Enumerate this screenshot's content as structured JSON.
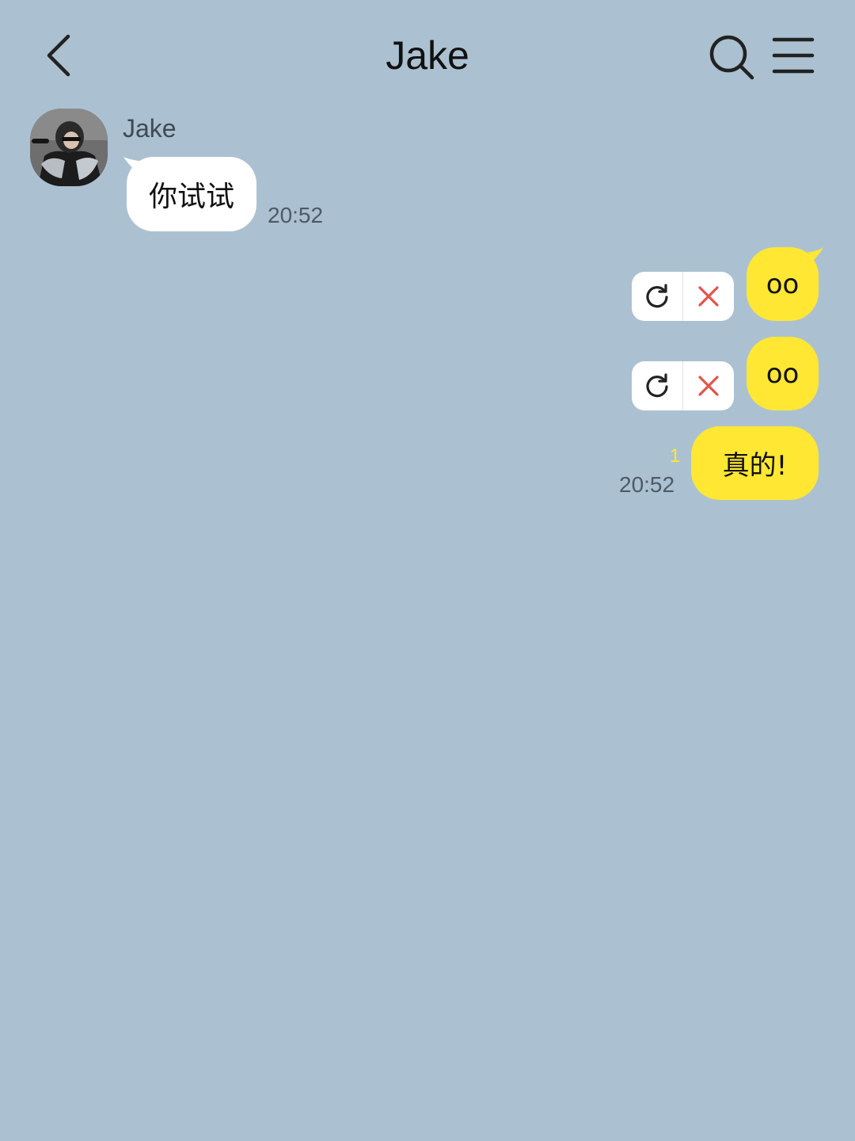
{
  "header": {
    "title": "Jake",
    "back_icon": "chevron-left-icon",
    "search_icon": "search-icon",
    "menu_icon": "hamburger-menu-icon"
  },
  "colors": {
    "background": "#abc1d1",
    "incoming_bubble": "#ffffff",
    "outgoing_bubble": "#ffe733",
    "delete_icon": "#e5534b"
  },
  "messages": {
    "incoming": [
      {
        "sender": "Jake",
        "text": "你试试",
        "time": "20:52"
      }
    ],
    "outgoing": [
      {
        "text": "oo",
        "status": "failed",
        "retry_icon": "refresh-icon",
        "delete_icon": "close-icon"
      },
      {
        "text": "oo",
        "status": "failed",
        "retry_icon": "refresh-icon",
        "delete_icon": "close-icon"
      },
      {
        "text": "真的!",
        "unread_count": "1",
        "time": "20:52"
      }
    ]
  }
}
